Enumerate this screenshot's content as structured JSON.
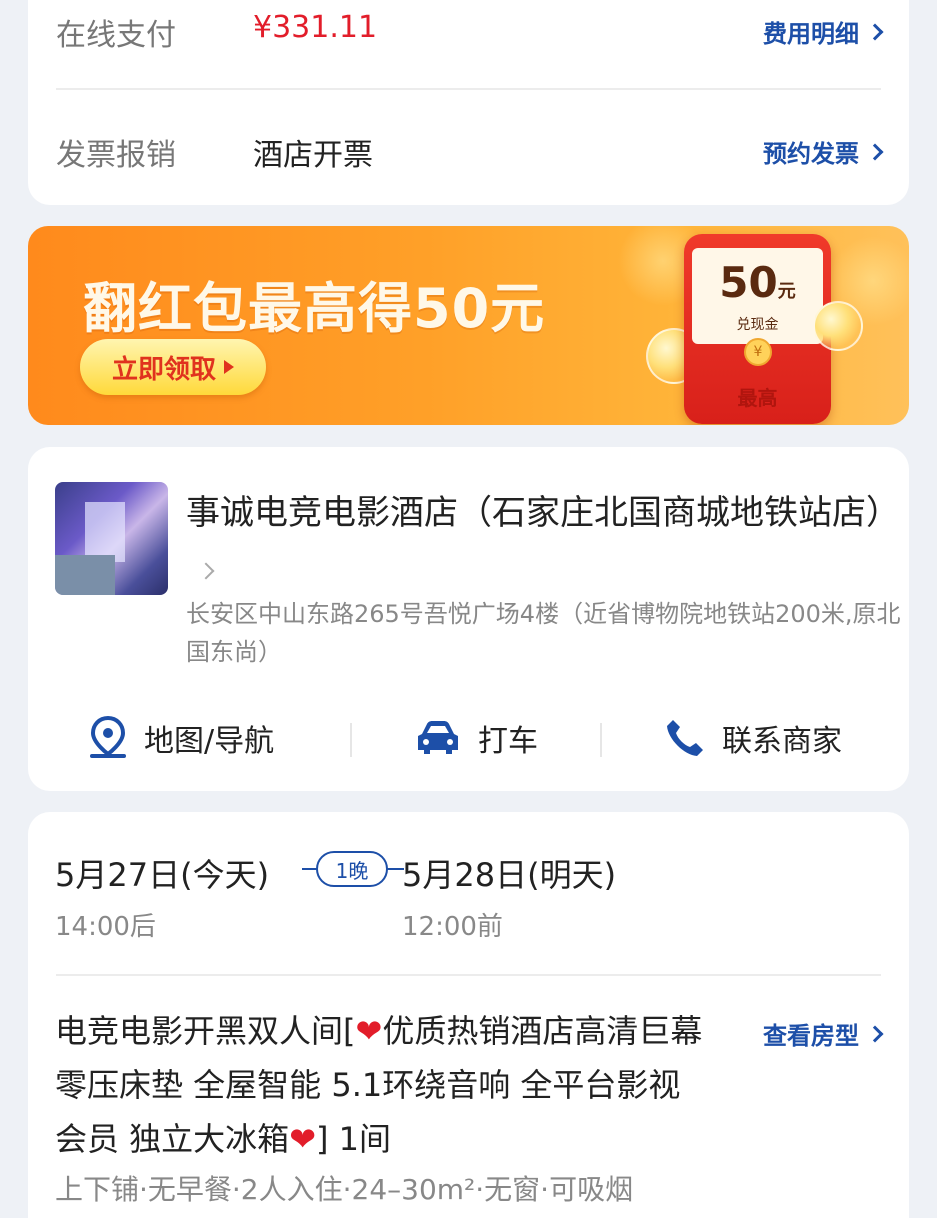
{
  "payment": {
    "online_label": "在线支付",
    "amount": "¥331.11",
    "fee_detail_link": "费用明细",
    "invoice_label": "发票报销",
    "invoice_value": "酒店开票",
    "invoice_link": "预约发票"
  },
  "banner": {
    "title": "翻红包最高得50元",
    "button": "立即领取",
    "envelope_amount": "50",
    "envelope_unit": "元",
    "envelope_type": "兑现金",
    "envelope_coin": "¥",
    "envelope_max": "最高"
  },
  "hotel": {
    "name": "事诚电竞电影酒店（石家庄北国商城地铁站店）",
    "address": "长安区中山东路265号吾悦广场4楼（近省博物院地铁站200米,原北国东尚）",
    "actions": [
      {
        "label": "地图/导航",
        "icon": "map-pin-icon"
      },
      {
        "label": "打车",
        "icon": "car-icon"
      },
      {
        "label": "联系商家",
        "icon": "phone-icon"
      }
    ]
  },
  "booking": {
    "checkin_date": "5月27日(今天)",
    "checkin_time": "14:00后",
    "nights": "1晚",
    "checkout_date": "5月28日(明天)",
    "checkout_time": "12:00前",
    "room_name_part1": "电竞电影开黑双人间[",
    "room_heart": "❤",
    "room_name_part2": "优质热销酒店高清巨幕 零压床垫 全屋智能 5.1环绕音响 全平台影视会员 独立大冰箱",
    "room_name_part3": "] 1间",
    "view_room_link": "查看房型",
    "room_features": "上下铺·无早餐·2人入住·24–30m²·无窗·可吸烟"
  },
  "colors": {
    "accent": "#1d4fa8",
    "price": "#e21d2a",
    "banner_orange": "#ff8a1c",
    "background": "#eef1f6"
  }
}
